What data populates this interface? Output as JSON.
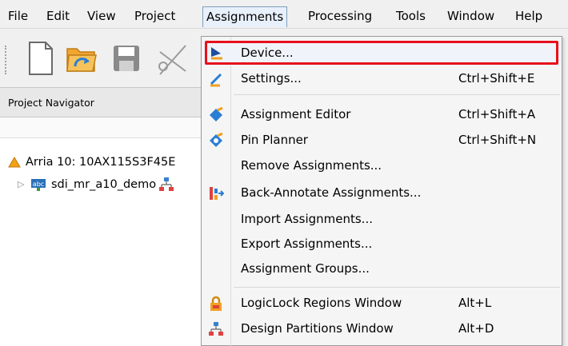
{
  "menubar": {
    "items": [
      "File",
      "Edit",
      "View",
      "Project",
      "Assignments",
      "Processing",
      "Tools",
      "Window",
      "Help"
    ]
  },
  "navigator": {
    "title": "Project Navigator",
    "device": "Arria 10: 10AX115S3F45E",
    "entity": "sdi_mr_a10_demo"
  },
  "dropdown": {
    "items": [
      {
        "label": "Device...",
        "shortcut": "",
        "icon": "device-icon"
      },
      {
        "label": "Settings...",
        "shortcut": "Ctrl+Shift+E",
        "icon": "settings-icon"
      },
      {
        "label": "Assignment Editor",
        "shortcut": "Ctrl+Shift+A",
        "icon": "assignment-editor-icon"
      },
      {
        "label": "Pin Planner",
        "shortcut": "Ctrl+Shift+N",
        "icon": "pin-planner-icon"
      },
      {
        "label": "Remove Assignments...",
        "shortcut": "",
        "icon": ""
      },
      {
        "label": "Back-Annotate Assignments...",
        "shortcut": "",
        "icon": "back-annotate-icon"
      },
      {
        "label": "Import Assignments...",
        "shortcut": "",
        "icon": ""
      },
      {
        "label": "Export Assignments...",
        "shortcut": "",
        "icon": ""
      },
      {
        "label": "Assignment Groups...",
        "shortcut": "",
        "icon": ""
      },
      {
        "label": "LogicLock Regions Window",
        "shortcut": "Alt+L",
        "icon": "lock-icon"
      },
      {
        "label": "Design Partitions Window",
        "shortcut": "Alt+D",
        "icon": "partitions-icon"
      }
    ]
  },
  "colors": {
    "highlight": "#e8101a",
    "menu_bg": "#f5f5f5",
    "accent_blue": "#1f6fd0"
  }
}
